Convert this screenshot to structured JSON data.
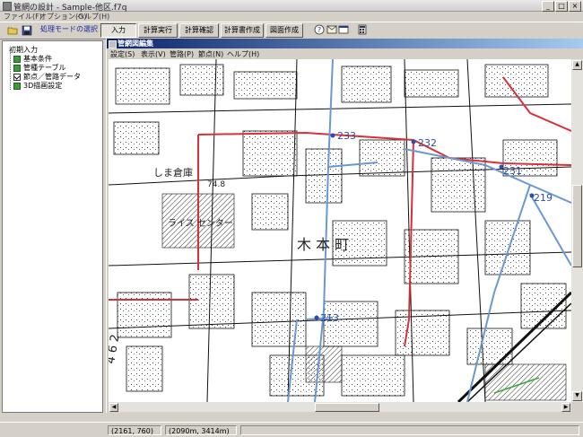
{
  "app": {
    "title": "管網の設計 - Sample-他区.f7q",
    "window_buttons": [
      "_",
      "□",
      "×"
    ]
  },
  "menubar": [
    "ファイル(F)",
    "オプション(O)",
    "ヘルプ(H)"
  ],
  "toolbar": {
    "mode_label": "処理モードの選択",
    "buttons": [
      "入力",
      "計算実行",
      "計算確認",
      "計算書作成",
      "図面作成"
    ],
    "active_button": "入力"
  },
  "tree": {
    "root": "初期入力",
    "items": [
      {
        "label": "基本条件",
        "kind": "box"
      },
      {
        "label": "管種テーブル",
        "kind": "box"
      },
      {
        "label": "節点／管路データ",
        "kind": "check"
      },
      {
        "label": "3D描画設定",
        "kind": "box"
      }
    ]
  },
  "child_window": {
    "title": "管網図編集",
    "menu": [
      "設定(S)",
      "表示(V)",
      "管路(P)",
      "節点(N)",
      "ヘルプ(H)"
    ]
  },
  "map": {
    "labels": [
      {
        "text": "233",
        "color": "#2a4db0"
      },
      {
        "text": "232",
        "color": "#2a4db0"
      },
      {
        "text": "231",
        "color": "#2a4db0"
      },
      {
        "text": "219",
        "color": "#2a4db0"
      },
      {
        "text": "213",
        "color": "#2a4db0"
      },
      {
        "text": "しま倉庫",
        "color": "#222222"
      },
      {
        "text": "74.8",
        "color": "#222222"
      },
      {
        "text": "ライス センター",
        "color": "#222222"
      },
      {
        "text": "木 本 町",
        "color": "#222222"
      },
      {
        "text": "4 6 2",
        "color": "#222222"
      }
    ],
    "colors": {
      "water_main": "#6a98d2",
      "boundary": "#d8303a",
      "extra": "#3aa83a"
    }
  },
  "statusbar": {
    "cursor": "(2161, 760)",
    "position": "(2090m, 3414m)"
  }
}
